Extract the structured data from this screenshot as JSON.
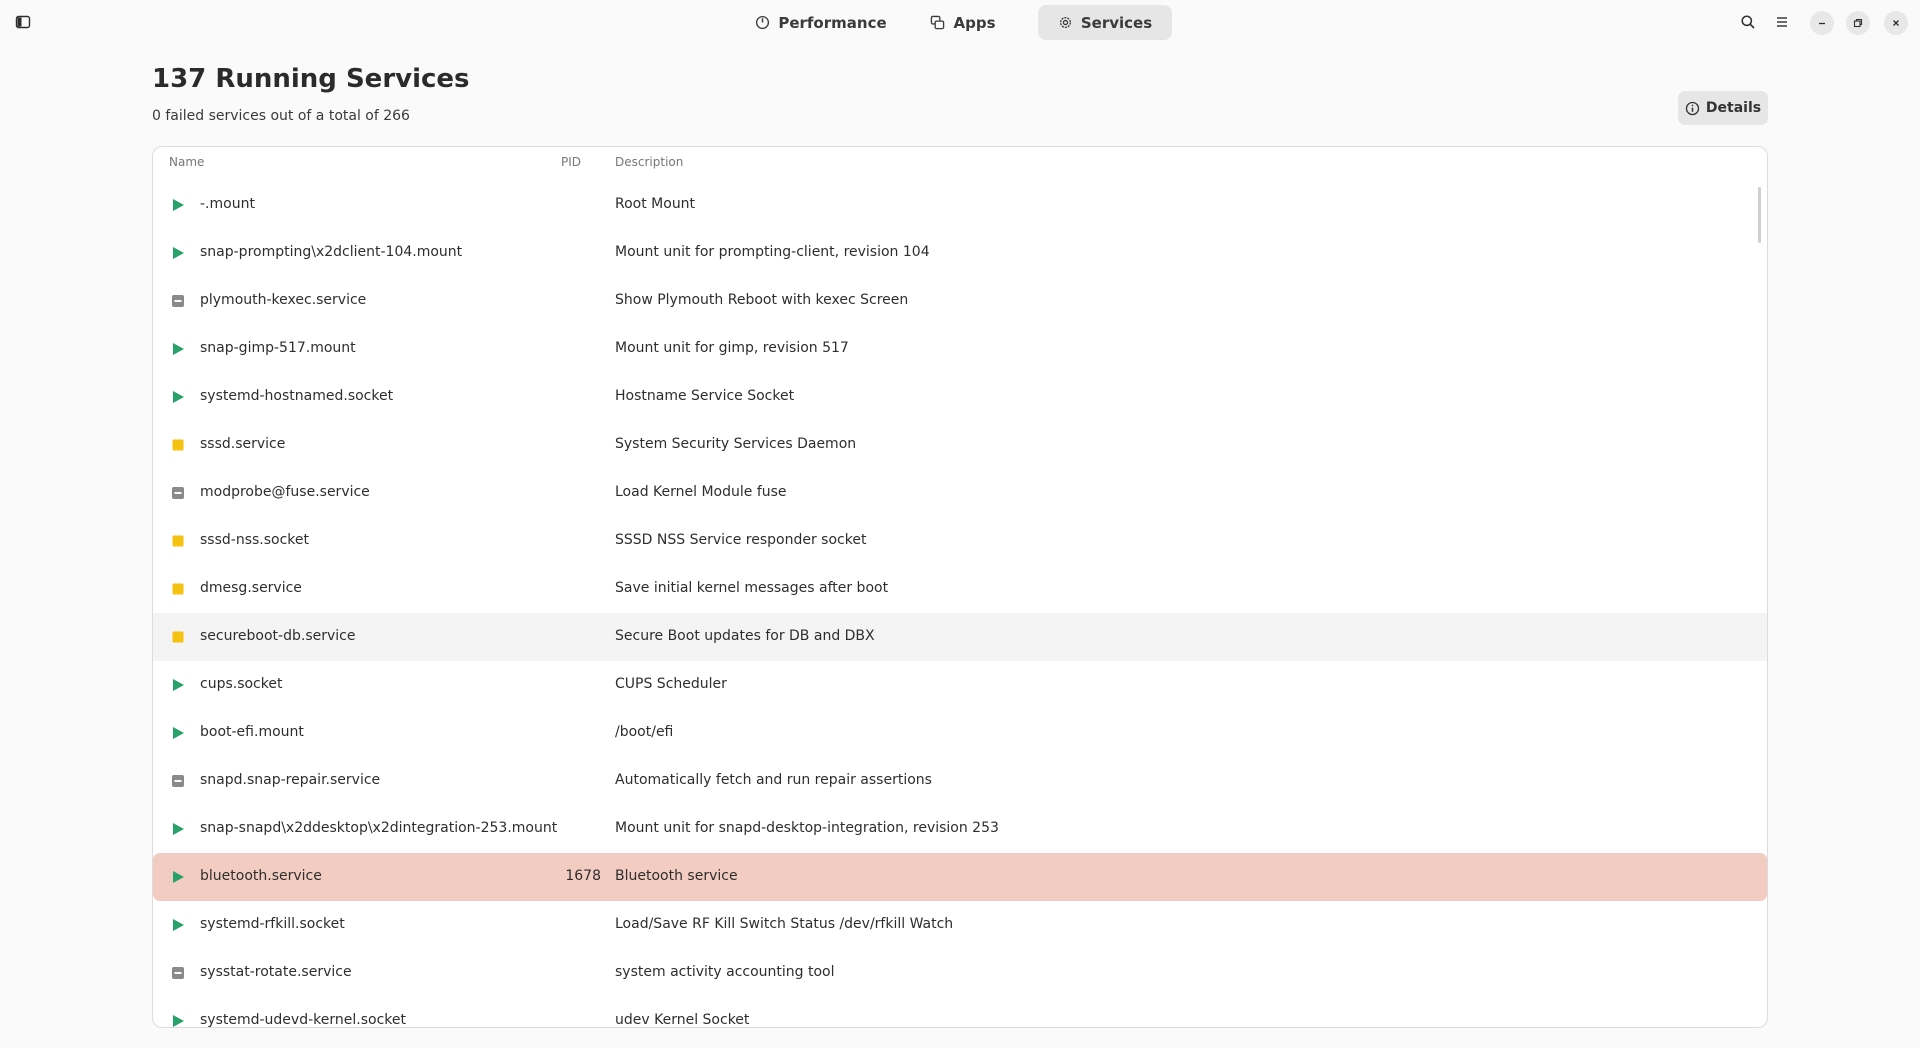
{
  "header": {
    "tabs": [
      {
        "label": "Performance",
        "icon": "gauge-icon"
      },
      {
        "label": "Apps",
        "icon": "windows-icon"
      },
      {
        "label": "Services",
        "icon": "gear-icon",
        "active": true
      }
    ]
  },
  "page": {
    "title": "137 Running Services",
    "subtitle": "0 failed services out of a total of 266",
    "details_label": "Details"
  },
  "table": {
    "columns": {
      "name": "Name",
      "pid": "PID",
      "description": "Description"
    },
    "rows": [
      {
        "status": "running",
        "name": "-.mount",
        "pid": "",
        "description": "Root Mount"
      },
      {
        "status": "running",
        "name": "snap-prompting\\x2dclient-104.mount",
        "pid": "",
        "description": "Mount unit for prompting-client, revision 104"
      },
      {
        "status": "inactive",
        "name": "plymouth-kexec.service",
        "pid": "",
        "description": "Show Plymouth Reboot with kexec Screen"
      },
      {
        "status": "running",
        "name": "snap-gimp-517.mount",
        "pid": "",
        "description": "Mount unit for gimp, revision 517"
      },
      {
        "status": "running",
        "name": "systemd-hostnamed.socket",
        "pid": "",
        "description": "Hostname Service Socket"
      },
      {
        "status": "stopped",
        "name": "sssd.service",
        "pid": "",
        "description": "System Security Services Daemon"
      },
      {
        "status": "inactive",
        "name": "modprobe@fuse.service",
        "pid": "",
        "description": "Load Kernel Module fuse"
      },
      {
        "status": "stopped",
        "name": "sssd-nss.socket",
        "pid": "",
        "description": "SSSD NSS Service responder socket"
      },
      {
        "status": "stopped",
        "name": "dmesg.service",
        "pid": "",
        "description": "Save initial kernel messages after boot"
      },
      {
        "status": "stopped",
        "name": "secureboot-db.service",
        "pid": "",
        "description": "Secure Boot updates for DB and DBX"
      },
      {
        "status": "running",
        "name": "cups.socket",
        "pid": "",
        "description": "CUPS Scheduler"
      },
      {
        "status": "running",
        "name": "boot-efi.mount",
        "pid": "",
        "description": "/boot/efi"
      },
      {
        "status": "inactive",
        "name": "snapd.snap-repair.service",
        "pid": "",
        "description": "Automatically fetch and run repair assertions"
      },
      {
        "status": "running",
        "name": "snap-snapd\\x2ddesktop\\x2dintegration-253.mount",
        "pid": "",
        "description": "Mount unit for snapd-desktop-integration, revision 253"
      },
      {
        "status": "running",
        "name": "bluetooth.service",
        "pid": "1678",
        "description": "Bluetooth service"
      },
      {
        "status": "running",
        "name": "systemd-rfkill.socket",
        "pid": "",
        "description": "Load/Save RF Kill Switch Status /dev/rfkill Watch"
      },
      {
        "status": "inactive",
        "name": "sysstat-rotate.service",
        "pid": "",
        "description": "system activity accounting tool"
      },
      {
        "status": "running",
        "name": "systemd-udevd-kernel.socket",
        "pid": "",
        "description": "udev Kernel Socket"
      }
    ],
    "hovered_row_name": "secureboot-db.service",
    "selected_row_name": "bluetooth.service"
  },
  "colors": {
    "running": "#26a269",
    "stopped": "#f5c211",
    "inactive": "#8a8a8a",
    "selected_row": "#f2ccc0"
  }
}
